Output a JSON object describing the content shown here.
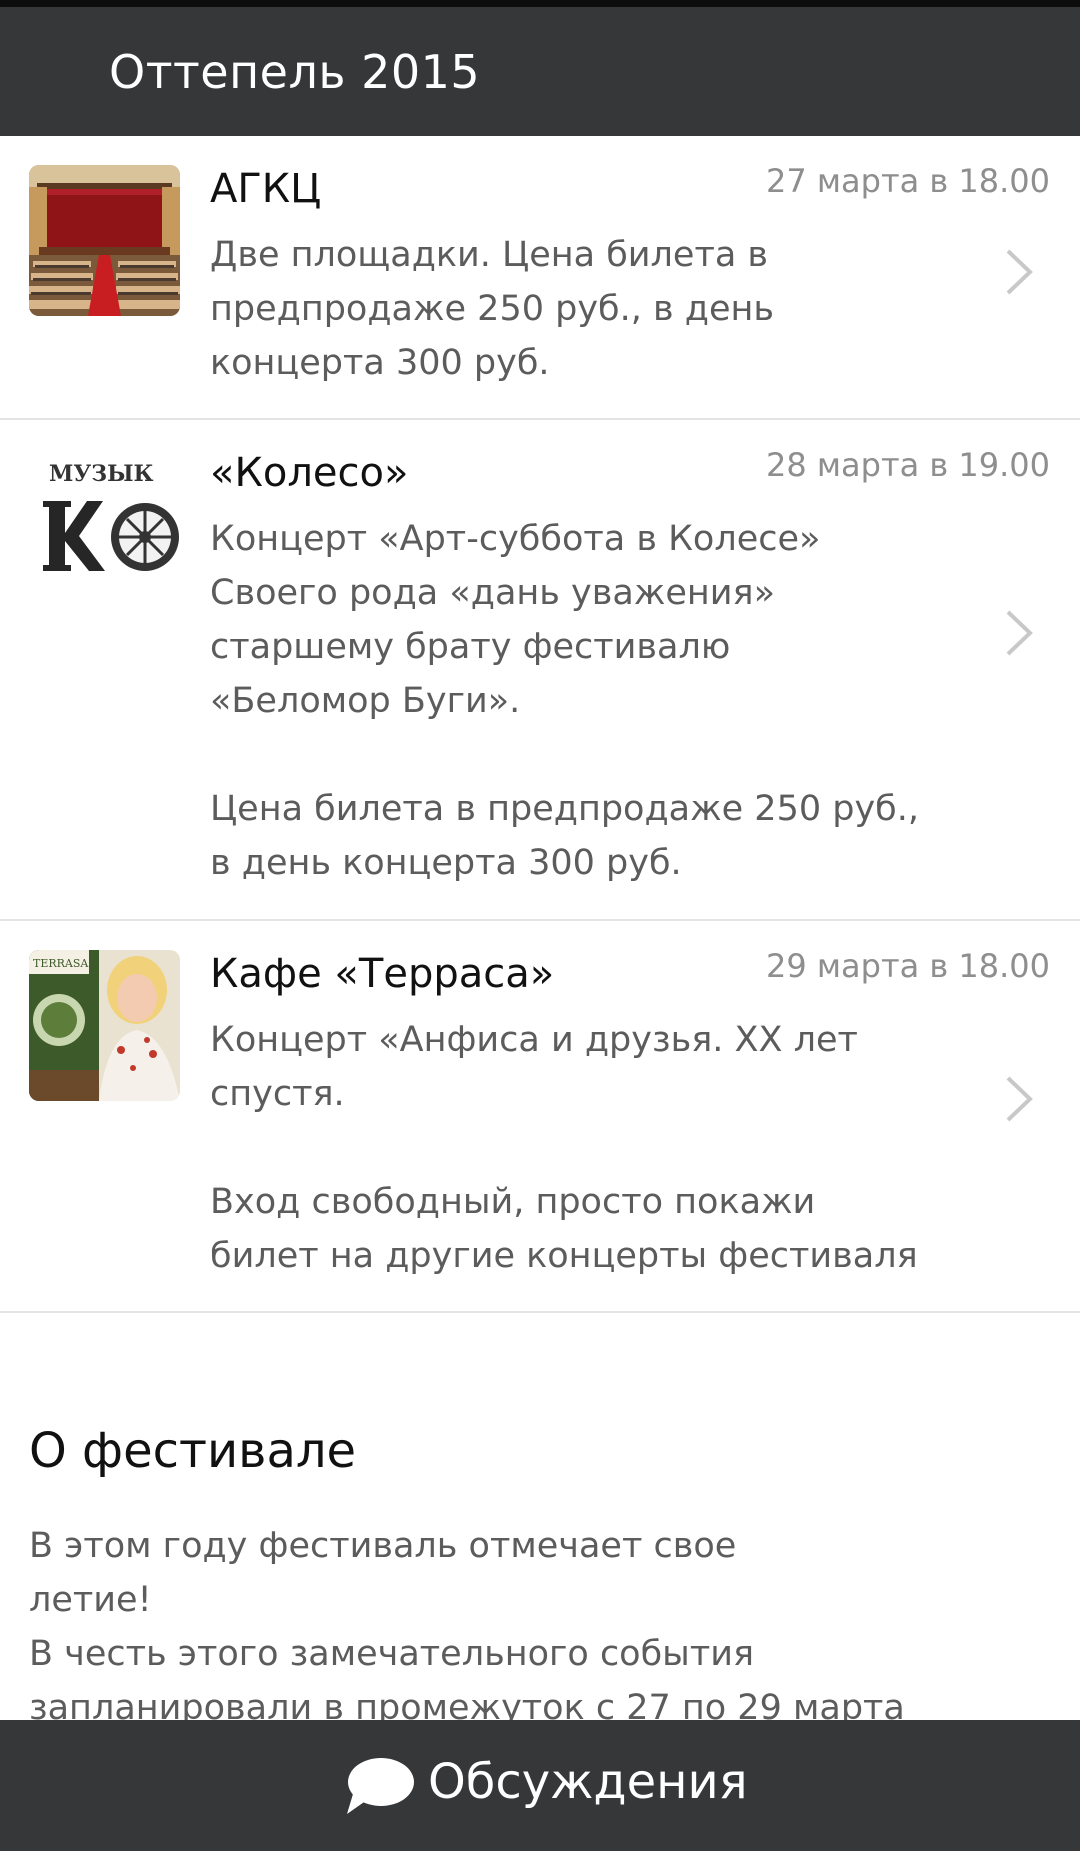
{
  "header": {
    "title": "Оттепель 2015"
  },
  "events": [
    {
      "venue": "АГКЦ",
      "date": "27 марта в 18.00",
      "description": "Две площадки. Цена билета в\nпредпродаже 250 руб., в день\nконцерта 300 руб.",
      "thumb_icon": "theater-hall-photo",
      "chevron_icon": "chevron-right-icon"
    },
    {
      "venue": "«Колесо»",
      "date": "28 марта в 19.00",
      "description": "Концерт «Арт-суббота в Колесе»\nСвоего рода «дань уважения»\nстаршему брату фестивалю\n«Беломор Буги».\n\nЦена билета в предпродаже 250 руб.,\nв день концерта 300 руб.",
      "thumb_icon": "koleso-logo",
      "thumb_logo_text": "МУЗЫК",
      "chevron_icon": "chevron-right-icon"
    },
    {
      "venue": "Кафе «Терраса»",
      "date": "29 марта в 18.00",
      "description": "Концерт «Анфиса и друзья. XX лет\nспустя.\n\nВход свободный, просто покажи\nбилет на другие концерты фестиваля",
      "thumb_icon": "terrasa-singer-photo",
      "thumb_logo_text": "TERRASA",
      "chevron_icon": "chevron-right-icon"
    }
  ],
  "about": {
    "title": "О фестивале",
    "text": "В этом году фестиваль отмечает свое\nлетие!\nВ честь этого замечательного события\nзапланировали в промежуток с 27 по 29 марта"
  },
  "bottom_bar": {
    "label": "Обсуждения",
    "icon": "speech-bubble-icon"
  },
  "colors": {
    "bar": "#353739",
    "date": "#8e8e8e",
    "body_text": "#5c5c5c",
    "divider": "#e4e4e4"
  }
}
